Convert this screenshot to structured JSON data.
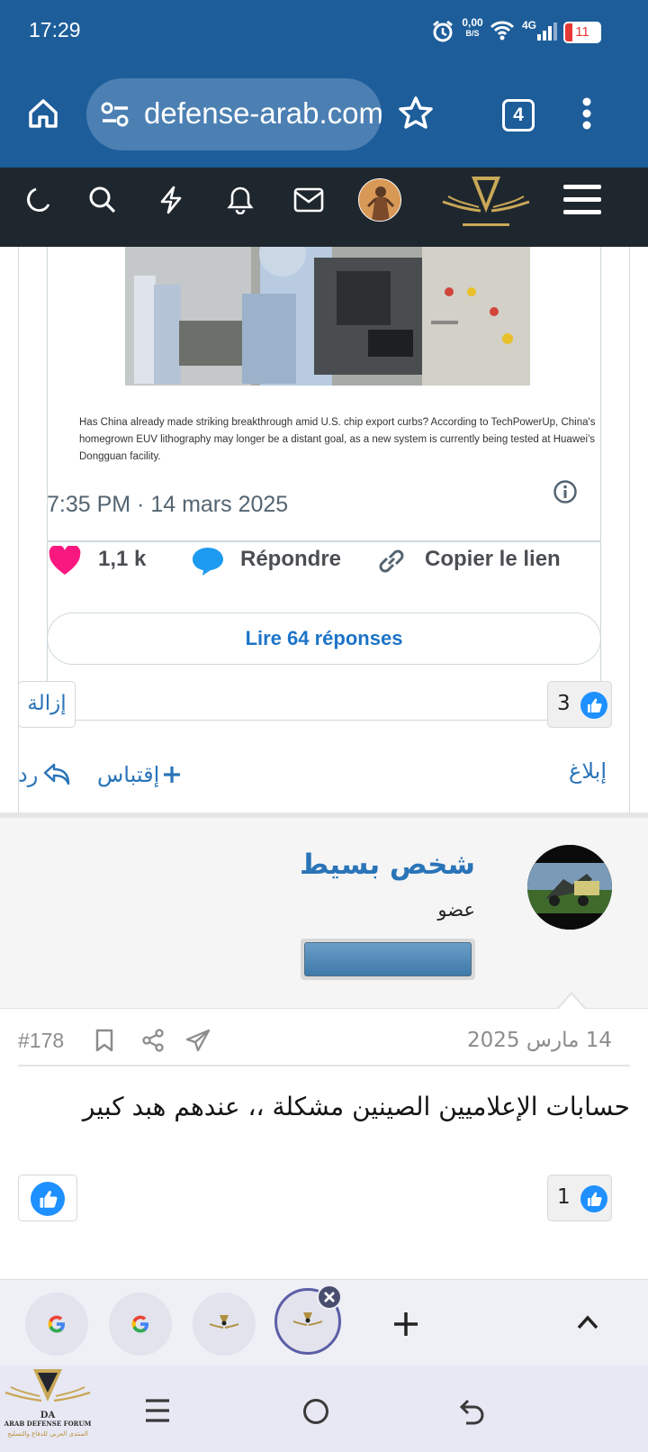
{
  "status_bar": {
    "time": "17:29",
    "net_speed_value": "0,00",
    "net_speed_unit": "B/S",
    "network_type": "4G",
    "battery": "11"
  },
  "browser": {
    "url": "defense-arab.com",
    "tab_count": "4"
  },
  "tweet": {
    "caption": "Has China already made striking breakthrough amid U.S. chip export curbs? According to TechPowerUp, China's homegrown EUV lithography may longer be a distant goal, as a new system is currently being tested at Huawei's Dongguan facility.",
    "time": "7:35 PM · 14 mars 2025",
    "likes": "1,1 k",
    "reply_label": "Répondre",
    "copy_link_label": "Copier le lien",
    "read_replies_label": "Lire 64 réponses"
  },
  "prev_post": {
    "remove_label": "إزالة",
    "like_count": "3",
    "reply_label": "رد",
    "quote_label": "إقتباس",
    "report_label": "إبلاغ"
  },
  "post": {
    "author": "شخص بسيط",
    "role": "عضو",
    "date": "14 مارس 2025",
    "number": "#178",
    "body": "حسابات الإعلاميين الصينين مشكلة ،، عندهم هبد كبير",
    "like_count": "1"
  },
  "footer_logo": {
    "line1": "ARAB DEFENSE FORUM",
    "line2": "المنتدى العربي للدفاع والتسليح"
  },
  "colors": {
    "chrome_blue": "#1d5d9a",
    "forum_bar": "#1f272e",
    "link_blue": "#2a74b8",
    "like_blue": "#1e90ff",
    "heart_pink": "#f91880"
  }
}
